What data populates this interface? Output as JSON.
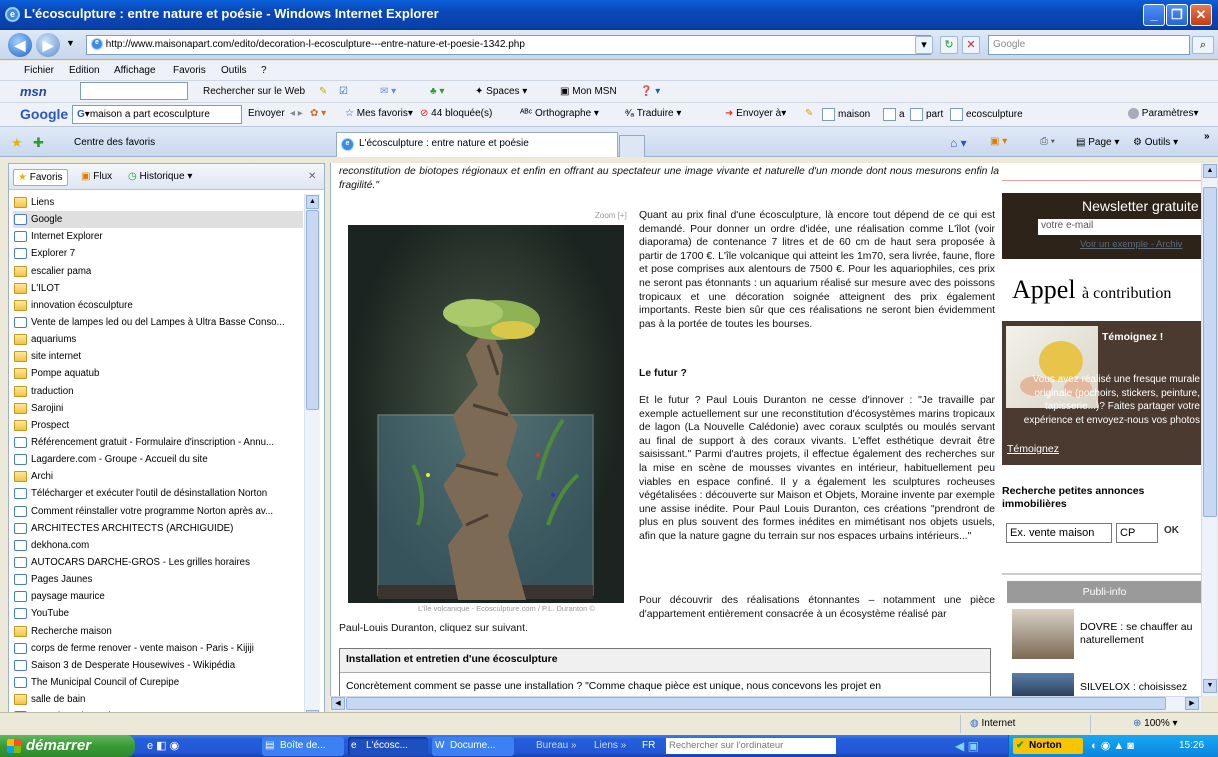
{
  "window": {
    "title": "L'écosculpture : entre nature et poésie - Windows Internet Explorer"
  },
  "address": {
    "url": "http://www.maisonapart.com/edito/decoration-l-ecosculpture---entre-nature-et-poesie-1342.php",
    "search_placeholder": "Google"
  },
  "menu": [
    "Fichier",
    "Edition",
    "Affichage",
    "Favoris",
    "Outils",
    "?"
  ],
  "msnbar": {
    "logo": "msn",
    "search_label": "Rechercher sur le Web",
    "spaces": "Spaces",
    "mon_msn": "Mon MSN"
  },
  "googlebar": {
    "logo": "Google",
    "query": "maison a part ecosculpture",
    "envoyer": "Envoyer",
    "mes_favoris": "Mes favoris",
    "bloquees": "44 bloquée(s)",
    "orthographe": "Orthographe",
    "traduire": "Traduire",
    "envoyer_a": "Envoyer à",
    "terms": [
      "maison",
      "a",
      "part",
      "ecosculpture"
    ],
    "parametres": "Paramètres"
  },
  "tabs": {
    "centre": "Centre des favoris",
    "current": "L'écosculpture : entre nature et poésie",
    "page": "Page",
    "outils": "Outils"
  },
  "sidebar": {
    "tabs": [
      "Favoris",
      "Flux",
      "Historique"
    ],
    "items": [
      {
        "label": "Liens",
        "kind": "folder"
      },
      {
        "label": "Google",
        "kind": "page",
        "selected": true
      },
      {
        "label": "Internet Explorer",
        "kind": "page"
      },
      {
        "label": "Explorer 7",
        "kind": "page"
      },
      {
        "label": "escalier pama",
        "kind": "folder"
      },
      {
        "label": "L'ILOT",
        "kind": "folder"
      },
      {
        "label": "innovation écosculpture",
        "kind": "folder"
      },
      {
        "label": "Vente de lampes led ou del Lampes à Ultra Basse Conso...",
        "kind": "page"
      },
      {
        "label": "aquariums",
        "kind": "folder"
      },
      {
        "label": "site internet",
        "kind": "folder"
      },
      {
        "label": "Pompe aquatub",
        "kind": "folder"
      },
      {
        "label": "traduction",
        "kind": "folder"
      },
      {
        "label": "Sarojini",
        "kind": "folder"
      },
      {
        "label": "Prospect",
        "kind": "folder"
      },
      {
        "label": "Référencement gratuit - Formulaire d'inscription - Annu...",
        "kind": "page"
      },
      {
        "label": "Lagardere.com - Groupe - Accueil du site",
        "kind": "page"
      },
      {
        "label": "Archi",
        "kind": "folder"
      },
      {
        "label": "Télécharger et exécuter l'outil de désinstallation Norton",
        "kind": "page"
      },
      {
        "label": "Comment réinstaller votre programme Norton après av...",
        "kind": "page"
      },
      {
        "label": "ARCHITECTES ARCHITECTS (ARCHIGUIDE)",
        "kind": "page"
      },
      {
        "label": "dekhona.com",
        "kind": "page"
      },
      {
        "label": "AUTOCARS DARCHE-GROS - Les grilles horaires",
        "kind": "page"
      },
      {
        "label": "Pages Jaunes",
        "kind": "page"
      },
      {
        "label": "paysage maurice",
        "kind": "page"
      },
      {
        "label": "YouTube",
        "kind": "page"
      },
      {
        "label": "Recherche maison",
        "kind": "folder"
      },
      {
        "label": "corps de ferme renover - vente maison - Paris - Kijiji",
        "kind": "page"
      },
      {
        "label": "Saison 3 de Desperate Housewives - Wikipédia",
        "kind": "page"
      },
      {
        "label": "The Municipal Council of Curepipe",
        "kind": "page"
      },
      {
        "label": "salle de bain",
        "kind": "folder"
      },
      {
        "label": "La Maison des Artistes",
        "kind": "page"
      }
    ]
  },
  "article": {
    "intro": "reconstitution de biotopes régionaux et enfin en offrant au spectateur une image vivante et naturelle d'un monde dont nous mesurons enfin la fragilité.\"",
    "zoom": "Zoom [+]",
    "caption": "L'île volcanique - Ecosculpture.com / P.L. Duranton ©",
    "p1": "Quant au prix final d'une écosculpture, là encore tout dépend de ce qui est demandé. Pour donner un ordre d'idée, une réalisation comme L'îlot (voir diaporama) de contenance 7 litres et de 60 cm de haut sera proposée à partir de 1700 €. L'île volcanique qui atteint les 1m70, sera livrée, faune, flore et pose comprises aux alentours de 7500 €. Pour les aquariophiles, ces prix ne seront pas étonnants : un aquarium réalisé sur mesure avec des poissons tropicaux et une décoration soignée atteignent des prix également importants. Reste bien sûr que ces réalisations ne seront bien évidemment pas à la portée de toutes les bourses.",
    "h_futur": "Le futur ?",
    "p2": "Et le futur ? Paul Louis Duranton ne cesse d'innover : \"Je travaille par exemple actuellement sur une reconstitution d'écosystèmes marins tropicaux de lagon (La Nouvelle Calédonie) avec coraux sculptés ou moulés servant au final de support à des coraux vivants. L'effet esthétique devrait être saisissant.\" Parmi d'autres projets, il effectue également des recherches sur la mise en scène de mousses vivantes en intérieur, habituellement peu viables en espace confiné. Il y a également les sculptures rocheuses végétalisées : découverte sur Maison et Objets, Moraine invente par exemple une assise inédite. Pour Paul Louis Duranton, ces créations \"prendront de plus en plus souvent des formes inédites en mimétisant nos objets usuels, afin que la nature gagne du terrain sur nos espaces urbains intérieurs...\"",
    "p3": "Pour découvrir des réalisations étonnantes – notamment une pièce d'appartement entièrement consacrée à un écosystème réalisé par",
    "p3b": "Paul-Louis Duranton, cliquez sur suivant.",
    "box_title": "Installation et entretien d'une écosculpture",
    "box_text": "Concrètement comment se passe une installation ? \"Comme chaque pièce est unique, nous concevons les projet en"
  },
  "right": {
    "newsletter": "Newsletter gratuite",
    "email_placeholder": "votre e-mail",
    "voir": "Voir un exemple - Archiv",
    "appel": "Appel",
    "appel2": "à contribution",
    "temoignez_title": "Témoignez !",
    "temoignez_text": "Vous avez réalisé une fresque murale originale (pochoirs, stickers, peinture, tapisserie...)? Faites partager votre expérience et envoyez-nous vos photos",
    "temoignez_link": "Témoignez",
    "recherche_title": "Recherche petites annonces immobilières",
    "recherche_value": "Ex. vente maison",
    "cp_value": "CP",
    "ok": "OK",
    "publi": "Publi-info",
    "ad1": "DOVRE : se chauffer au naturellement",
    "ad2": "SILVELOX : choisissez"
  },
  "status": {
    "zone": "Internet",
    "zoom": "100%"
  },
  "taskbar": {
    "start": "démarrer",
    "tasks": [
      "Boîte de...",
      "L'écosc...",
      "Docume..."
    ],
    "bureau": "Bureau",
    "liens": "Liens",
    "lang": "FR",
    "search": "Rechercher sur l'ordinateur",
    "norton": "Norton",
    "time": "15:26"
  }
}
